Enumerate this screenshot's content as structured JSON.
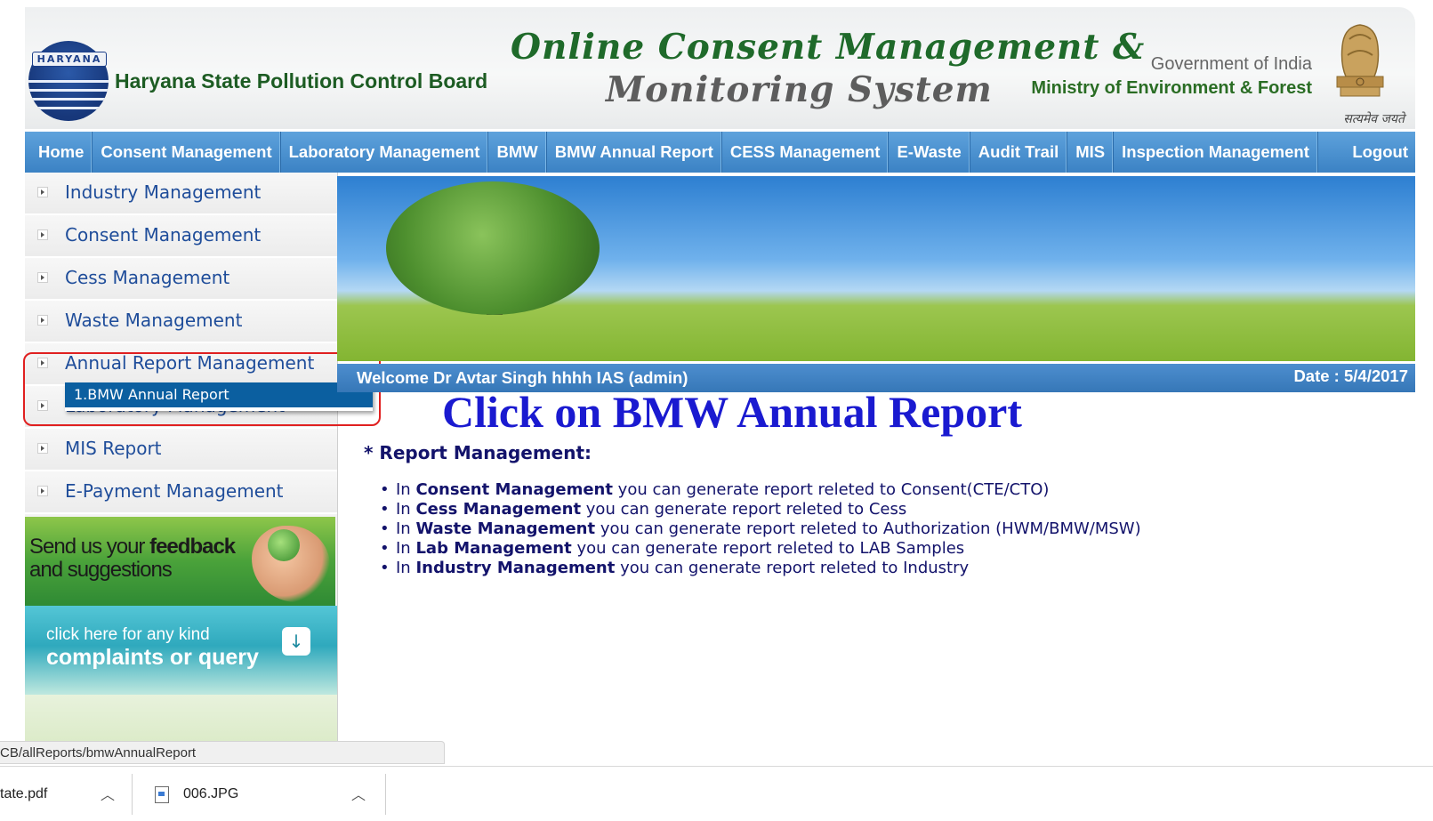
{
  "header": {
    "logo_text": "HARYANA",
    "org_name": "Haryana State Pollution Control Board",
    "title_line1": "Online Consent Management &",
    "title_line2": "Monitoring System",
    "gov_line": "Government of India",
    "ministry_line": "Ministry of Environment & Forest",
    "emblem_caption": "सत्यमेव जयते"
  },
  "nav": {
    "items": [
      "Home",
      "Consent Management",
      "Laboratory Management",
      "BMW",
      "BMW Annual Report",
      "CESS Management",
      "E-Waste",
      "Audit Trail",
      "MIS",
      "Inspection Management",
      "Logout"
    ]
  },
  "sidebar": {
    "items": [
      "Industry Management",
      "Consent Management",
      "Cess Management",
      "Waste Management",
      "Annual Report Management",
      "Laboratory Management",
      "MIS Report",
      "E-Payment Management"
    ],
    "popup_item": "1.BMW Annual Report",
    "feedback_line1_prefix": "Send us your ",
    "feedback_line1_bold": "feedback",
    "feedback_line2": "and suggestions",
    "complaint_line1": "click here for any kind",
    "complaint_line2": "complaints or query"
  },
  "main": {
    "welcome": "Welcome Dr Avtar Singh hhhh IAS (admin)",
    "date": "Date : 5/4/2017",
    "annotation": "Click on BMW Annual Report",
    "report_heading": "* Report Management:",
    "report_items": [
      {
        "pre": "In ",
        "bold": "Consent Management",
        "post": " you can generate report releted to Consent(CTE/CTO)"
      },
      {
        "pre": "In ",
        "bold": "Cess Management",
        "post": " you can generate report releted to Cess"
      },
      {
        "pre": "In ",
        "bold": "Waste Management",
        "post": " you can generate report releted to Authorization (HWM/BMW/MSW)"
      },
      {
        "pre": "In ",
        "bold": "Lab Management",
        "post": " you can generate report releted to LAB Samples"
      },
      {
        "pre": "In ",
        "bold": "Industry Management",
        "post": " you can generate report releted to Industry"
      }
    ]
  },
  "status_bar": {
    "url": "CB/allReports/bmwAnnualReport"
  },
  "downloads": [
    {
      "name": "tate.pdf",
      "icon": "pdf-file-icon"
    },
    {
      "name": "006.JPG",
      "icon": "image-file-icon"
    }
  ],
  "colors": {
    "nav_bg": "#3b82c4",
    "sidebar_link": "#1f4d9a",
    "annotation": "#1a1ad0",
    "highlight": "#e02020",
    "popup_bg": "#0b5fa0"
  }
}
